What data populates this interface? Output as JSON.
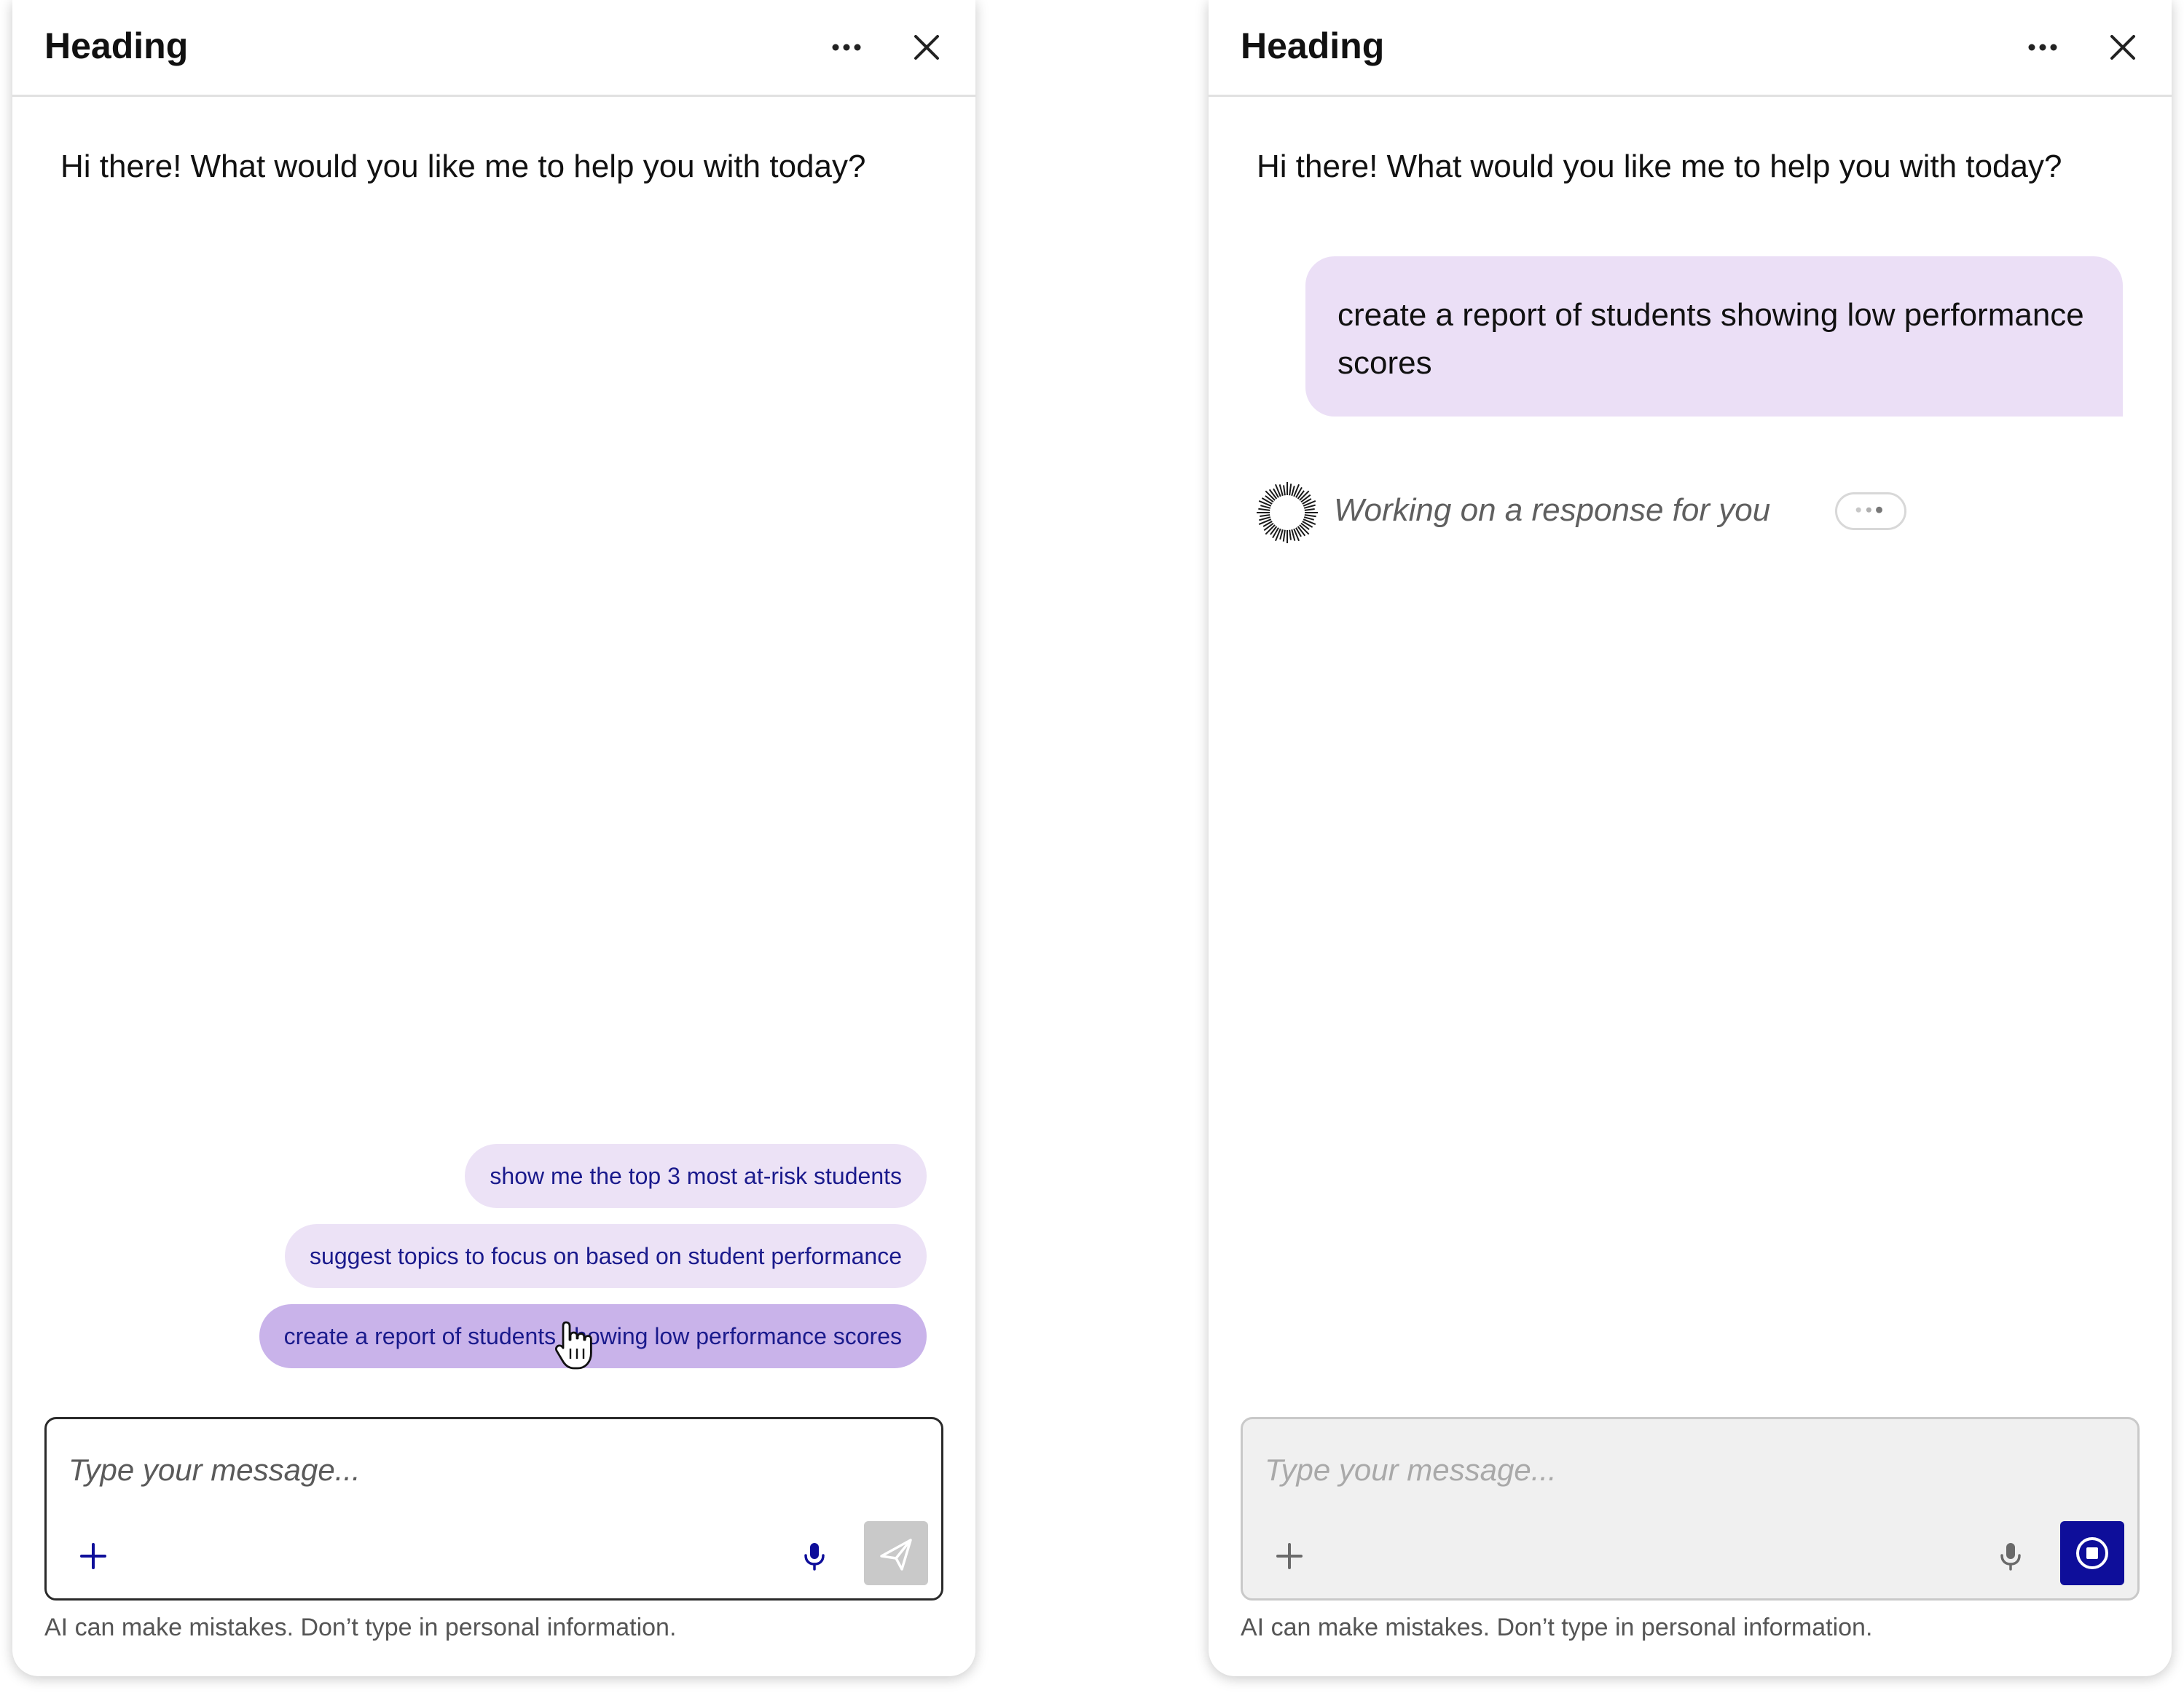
{
  "colors": {
    "accent": "#0e0e9a",
    "suggestion_bg": "#ece2f6",
    "suggestion_active_bg": "#c9b3ea",
    "user_bubble_bg": "#ebdff6"
  },
  "left_panel": {
    "header": {
      "title": "Heading",
      "more_icon": "more-horizontal-icon",
      "close_icon": "close-icon"
    },
    "greeting": "Hi there! What would you like me to help you with today?",
    "suggestions": [
      {
        "label": "show me the top 3 most at-risk students"
      },
      {
        "label": "suggest topics to focus on based on student performance"
      },
      {
        "label": "create a report of students showing low performance scores",
        "state": "hover"
      }
    ],
    "composer": {
      "placeholder": "Type your message...",
      "value": "",
      "icons": [
        "plus-icon",
        "microphone-icon",
        "send-icon"
      ],
      "send_enabled": false
    },
    "disclaimer": "AI can make mistakes. Don’t type in personal information."
  },
  "right_panel": {
    "header": {
      "title": "Heading",
      "more_icon": "more-horizontal-icon",
      "close_icon": "close-icon"
    },
    "greeting": "Hi there! What would you like me to help you with today?",
    "user_message": "create a report of students showing low performance scores",
    "status": {
      "text": "Working on a response for you",
      "icon": "loading-spinner-icon"
    },
    "composer": {
      "placeholder": "Type your message...",
      "value": "",
      "disabled": true,
      "icons": [
        "plus-icon",
        "microphone-icon",
        "stop-icon"
      ]
    },
    "disclaimer": "AI can make mistakes. Don’t type in personal information."
  }
}
